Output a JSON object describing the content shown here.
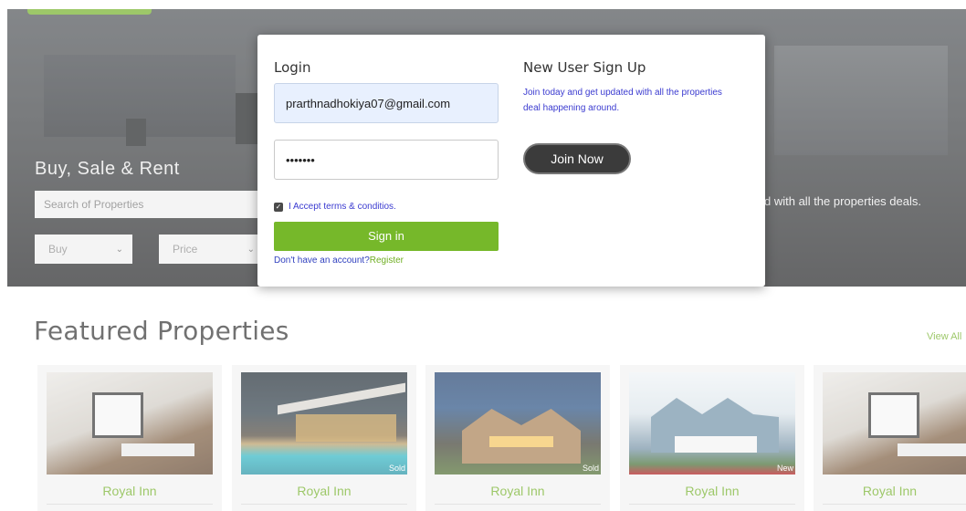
{
  "hero": {
    "title": "Buy, Sale & Rent",
    "search_placeholder": "Search of Properties",
    "buy_select": "Buy",
    "price_select": "Price",
    "tagline": "d with all the properties deals."
  },
  "featured": {
    "title": "Featured Properties",
    "view_all": "View All"
  },
  "cards": [
    {
      "name": "Royal Inn",
      "badge": "",
      "image": "interior"
    },
    {
      "name": "Royal Inn",
      "badge": "Sold",
      "image": "pool-house"
    },
    {
      "name": "Royal Inn",
      "badge": "Sold",
      "image": "house-at-dusk"
    },
    {
      "name": "Royal Inn",
      "badge": "New",
      "image": "blue-house"
    },
    {
      "name": "Royal Inn",
      "badge": "",
      "image": "interior"
    }
  ],
  "modal": {
    "login": {
      "heading": "Login",
      "email_value": "prarthnadhokiya07@gmail.com",
      "password_value": "•••••••",
      "terms_label": "I Accept terms & conditios.",
      "terms_checked": true,
      "signin_label": "Sign in",
      "register_prompt": "Don't have an account?",
      "register_link": "Register"
    },
    "signup": {
      "heading": "New User Sign Up",
      "text": "Join today and get updated with all the properties deal happening around.",
      "join_label": "Join Now"
    }
  },
  "colors": {
    "accent_green": "#76b82a",
    "link_blue": "#3b3bd0",
    "join_button": "#3b3b3b"
  }
}
